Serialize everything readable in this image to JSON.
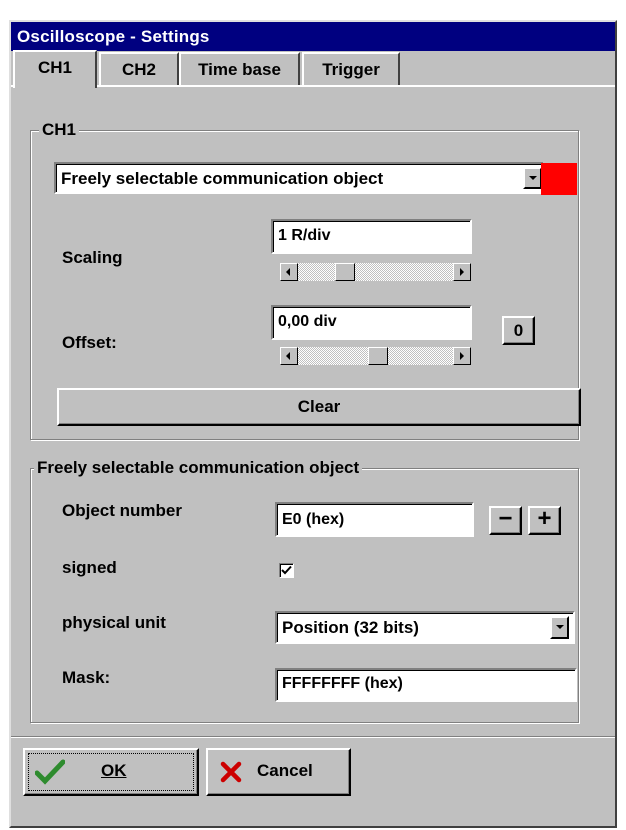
{
  "window": {
    "title": "Oscilloscope - Settings"
  },
  "tabs": [
    {
      "label": "CH1",
      "active": true
    },
    {
      "label": "CH2",
      "active": false
    },
    {
      "label": "Time base",
      "active": false
    },
    {
      "label": "Trigger",
      "active": false
    }
  ],
  "ch1_group": {
    "title": "CH1",
    "source_select": {
      "value": "Freely selectable communication object"
    },
    "color_swatch": {
      "color": "#ff0000"
    },
    "scaling": {
      "label": "Scaling",
      "value": "1  R/div"
    },
    "offset": {
      "label": "Offset:",
      "value": "0,00 div",
      "zero_button": "0"
    },
    "clear_button": "Clear"
  },
  "comm_group": {
    "title": "Freely selectable communication object",
    "object_number": {
      "label": "Object number",
      "value": "E0 (hex)",
      "minus": "−",
      "plus": "+"
    },
    "signed": {
      "label": "signed",
      "checked": true
    },
    "physical_unit": {
      "label": "physical unit",
      "value": "Position (32 bits)"
    },
    "mask": {
      "label": "Mask:",
      "value": "FFFFFFFF (hex)"
    }
  },
  "footer": {
    "ok": {
      "label": "OK",
      "icon": "checkmark-icon",
      "color": "#2e8b2e"
    },
    "cancel": {
      "label": "Cancel",
      "icon": "x-icon",
      "color": "#cc0000"
    }
  }
}
